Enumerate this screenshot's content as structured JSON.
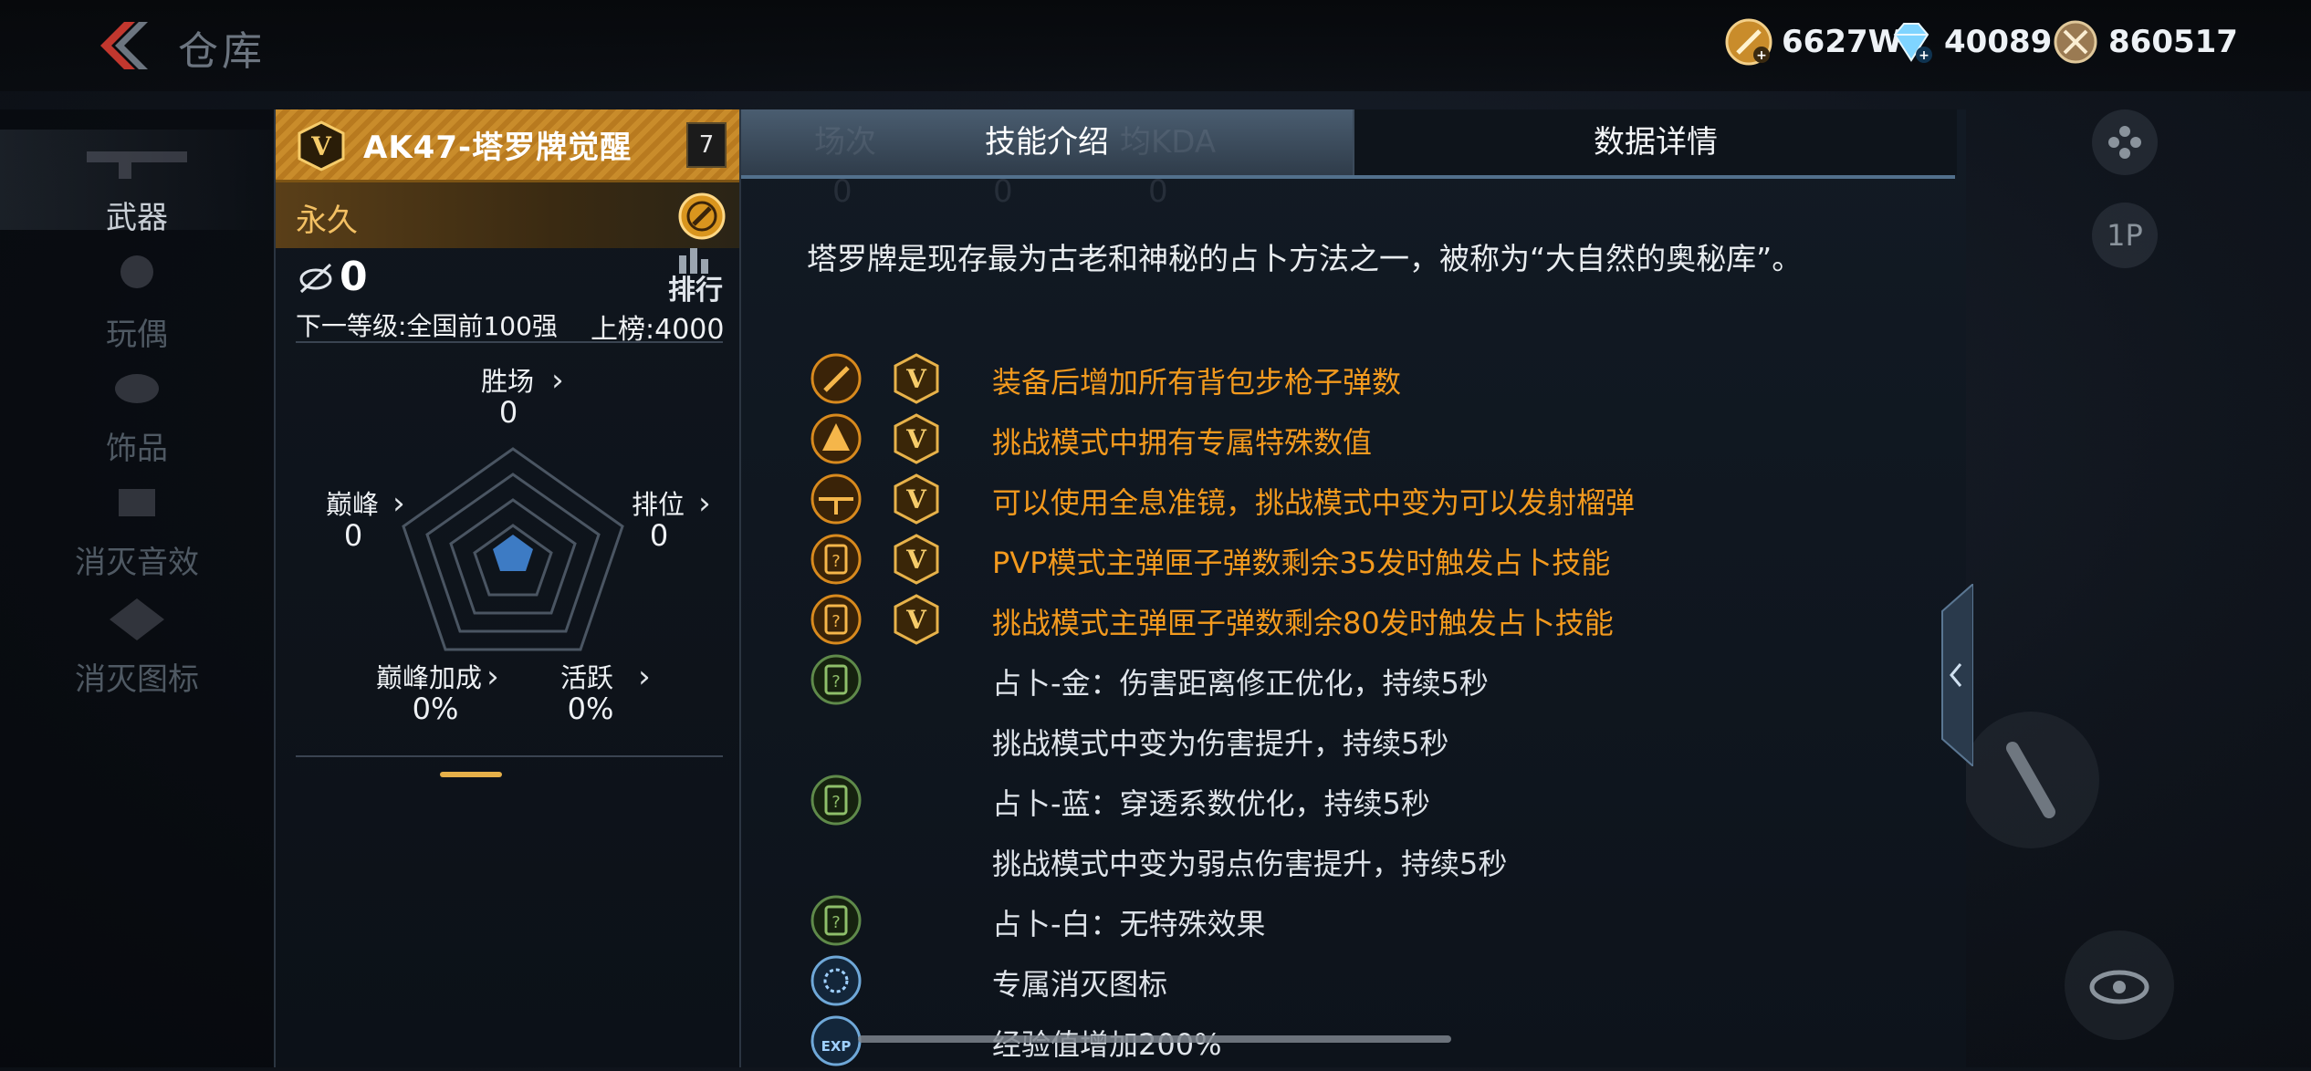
{
  "header": {
    "title": "仓库",
    "currencies": [
      {
        "icon": "gold-coin-icon",
        "value": "6627W"
      },
      {
        "icon": "diamond-icon",
        "value": "40089"
      },
      {
        "icon": "honor-medal-icon",
        "value": "860517"
      }
    ]
  },
  "sidebar": {
    "items": [
      {
        "label": "武器",
        "active": true
      },
      {
        "label": "玩偶",
        "active": false
      },
      {
        "label": "饰品",
        "active": false
      },
      {
        "label": "消灭音效",
        "active": false
      },
      {
        "label": "消灭图标",
        "active": false
      }
    ]
  },
  "right_rail": {
    "mode_badge": "1P"
  },
  "weapon": {
    "name": "AK47-塔罗牌觉醒",
    "level": "7",
    "duration": "永久",
    "kills": "0",
    "rank_label": "排行",
    "next_level": "下一等级:全国前100强",
    "on_board": "上榜:4000",
    "stats": {
      "win": {
        "label": "胜场",
        "value": "0"
      },
      "peak": {
        "label": "巅峰",
        "value": "0"
      },
      "ranked": {
        "label": "排位",
        "value": "0"
      },
      "peak_bonus": {
        "label": "巅峰加成",
        "value": "0%"
      },
      "active": {
        "label": "活跃",
        "value": "0%"
      }
    }
  },
  "tabs": {
    "skill": "技能介绍",
    "data": "数据详情",
    "ghost_headers": [
      "场次",
      "均KDA"
    ],
    "ghost_values": [
      "0",
      "0",
      "0"
    ]
  },
  "skills": {
    "intro": "塔罗牌是现存最为古老和神秘的占卜方法之一，被称为“大自然的奥秘库”。",
    "items": [
      {
        "icon": "rifle-ammo-icon",
        "has_v": true,
        "text": "装备后增加所有背包步枪子弹数",
        "color": "orange"
      },
      {
        "icon": "challenge-mode-icon",
        "has_v": true,
        "text": "挑战模式中拥有专属特殊数值",
        "color": "orange"
      },
      {
        "icon": "scope-icon",
        "has_v": true,
        "text": "可以使用全息准镜，挑战模式中变为可以发射榴弹",
        "color": "orange"
      },
      {
        "icon": "tarot-card-icon",
        "has_v": true,
        "text": "PVP模式主弹匣子弹数剩余35发时触发占卜技能",
        "color": "orange"
      },
      {
        "icon": "tarot-card-icon",
        "has_v": true,
        "text": "挑战模式主弹匣子弹数剩余80发时触发占卜技能",
        "color": "orange"
      },
      {
        "icon": "tarot-card-green-icon",
        "has_v": false,
        "text": "占卜-金：伤害距离修正优化，持续5秒",
        "color": "white"
      },
      {
        "icon": "",
        "has_v": false,
        "text": "挑战模式中变为伤害提升，持续5秒",
        "color": "white"
      },
      {
        "icon": "tarot-card-green-icon",
        "has_v": false,
        "text": "占卜-蓝：穿透系数优化，持续5秒",
        "color": "white"
      },
      {
        "icon": "",
        "has_v": false,
        "text": "挑战模式中变为弱点伤害提升，持续5秒",
        "color": "white"
      },
      {
        "icon": "tarot-card-green-icon",
        "has_v": false,
        "text": "占卜-白：无特殊效果",
        "color": "white"
      },
      {
        "icon": "kill-icon-badge-icon",
        "has_v": false,
        "text": "专属消灭图标",
        "color": "white"
      },
      {
        "icon": "exp-boost-icon",
        "has_v": false,
        "text": "经验值增加200%",
        "color": "white"
      }
    ]
  },
  "colors": {
    "accent_orange": "#f39a1e",
    "gold": "#c98c2b",
    "tab_active": "#4a5d70"
  }
}
